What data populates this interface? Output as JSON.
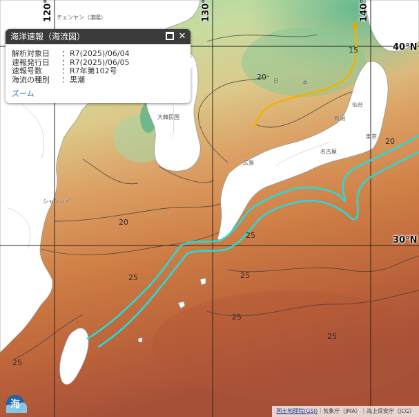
{
  "map": {
    "grid_labels": {
      "lon": [
        "120°E",
        "130°E",
        "140°E"
      ],
      "lat": [
        "40°N",
        "30°N"
      ]
    },
    "isotherm_labels": [
      "15",
      "20",
      "20",
      "25",
      "25",
      "25",
      "25",
      "25",
      "25",
      "20"
    ],
    "place_labels": [
      "大韓民国",
      "日",
      "本",
      "広島",
      "名古屋",
      "東京",
      "仙台",
      "新潟",
      "チェンヤン（瀋陽）",
      "シャンハイ"
    ],
    "colors": {
      "cold": "#4fb08a",
      "mild": "#c9d58f",
      "warm": "#d68a48",
      "hot": "#b35a37",
      "current_kuroshio": "#22dcdc",
      "current_tsushima": "#f2b200",
      "land": "#ffffff"
    }
  },
  "popup": {
    "title": "海洋速報（海流図）",
    "rows": [
      {
        "key": "解析対象日",
        "sep": "：",
        "value": "R7(2025)/06/04"
      },
      {
        "key": "速報発行日",
        "sep": "：",
        "value": "R7(2025)/06/05"
      },
      {
        "key": "速報号数",
        "sep": "：",
        "value": "R7年第102号"
      },
      {
        "key": "海流の種別",
        "sep": "：",
        "value": "黒潮"
      }
    ],
    "zoom_label": "ズーム",
    "maximize_icon": "maximize-icon",
    "close_icon": "close-icon",
    "close_glyph": "✕"
  },
  "attribution": {
    "gsi_label": "国土地理院(GSI)",
    "rest": "｜気象庁（JMA）｜海上保安庁（JCG）"
  },
  "logo": {
    "text": "海",
    "icon": "umi-logo-icon"
  }
}
